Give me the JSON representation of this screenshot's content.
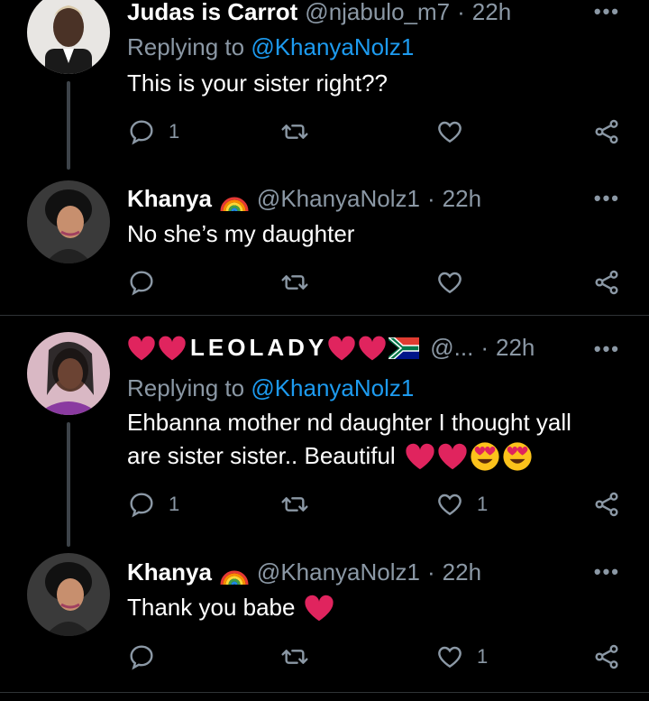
{
  "tweets": [
    {
      "name": "Judas is Carrot",
      "handle": "@njabulo_m7",
      "time": "22h",
      "replying_prefix": "Replying to ",
      "replying_handle": "@KhanyaNolz1",
      "text": "This is your sister right??",
      "replies": "1",
      "likes": ""
    },
    {
      "name": "Khanya",
      "handle": "@KhanyaNolz1",
      "time": "22h",
      "text": "No she’s my daughter",
      "replies": "",
      "likes": ""
    },
    {
      "name": "LEOLADY",
      "handle": "@...",
      "time": "22h",
      "replying_prefix": "Replying to ",
      "replying_handle": "@KhanyaNolz1",
      "text_line1": "Ehbanna mother nd daughter I thought yall",
      "text_line2": "are sister sister.. Beautiful",
      "replies": "1",
      "likes": "1"
    },
    {
      "name": "Khanya",
      "handle": "@KhanyaNolz1",
      "time": "22h",
      "text": "Thank you babe",
      "replies": "",
      "likes": "1"
    }
  ],
  "separator": "·",
  "more_glyph": "•••",
  "colors": {
    "background": "#000000",
    "text": "#ffffff",
    "muted": "#8b98a5",
    "link": "#1d9bf0",
    "heart": "#e0245e",
    "divider": "#2f3336"
  },
  "icons": [
    "reply-icon",
    "retweet-icon",
    "like-icon",
    "share-icon",
    "rainbow-emoji",
    "red-heart-emoji",
    "heart-eyes-emoji",
    "south-africa-flag-emoji"
  ]
}
